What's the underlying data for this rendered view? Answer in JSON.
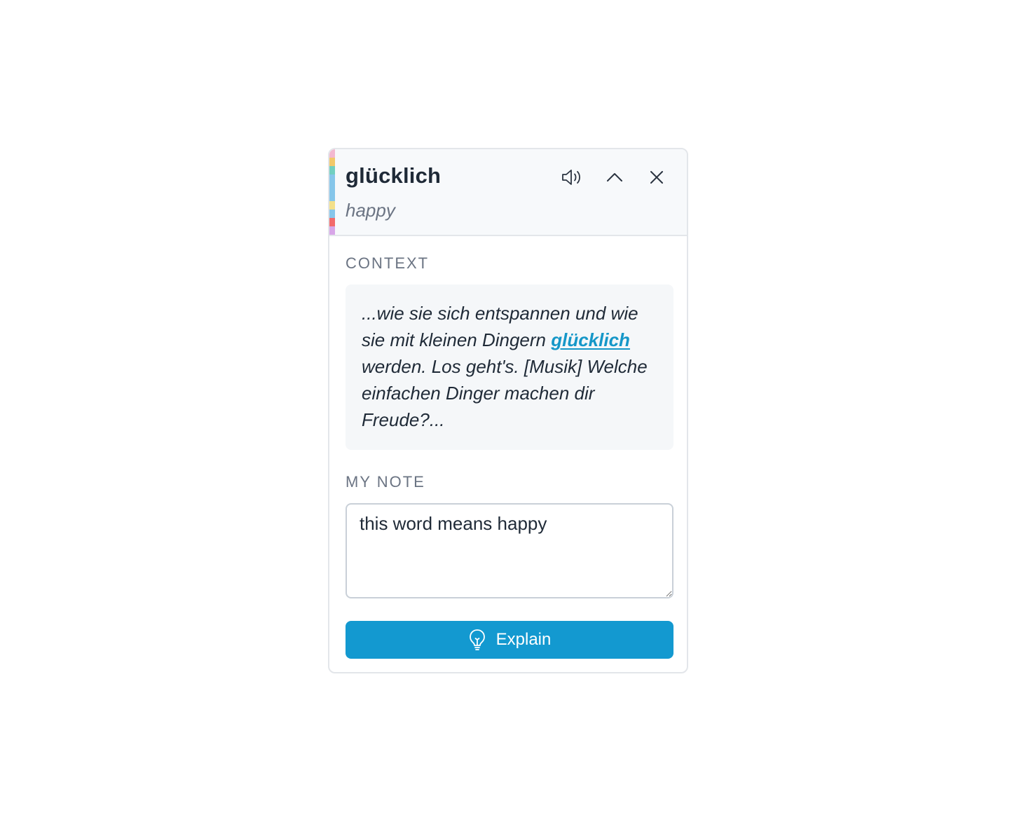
{
  "popup": {
    "word": "glücklich",
    "translation": "happy",
    "actions": {
      "speaker_icon": "speaker-icon",
      "collapse_icon": "chevron-up-icon",
      "close_icon": "close-icon"
    }
  },
  "context": {
    "label": "CONTEXT",
    "before": "...wie sie sich entspannen und wie sie mit kleinen Dingern ",
    "highlight": "glücklich",
    "after": " werden. Los geht's. [Musik] Welche einfachen Dinger machen dir Freude?..."
  },
  "note": {
    "label": "MY NOTE",
    "value": "this word means happy"
  },
  "explain": {
    "label": "Explain",
    "icon": "lightbulb-icon"
  },
  "colors": {
    "accent": "#1399d0",
    "highlight": "#1597c8"
  }
}
